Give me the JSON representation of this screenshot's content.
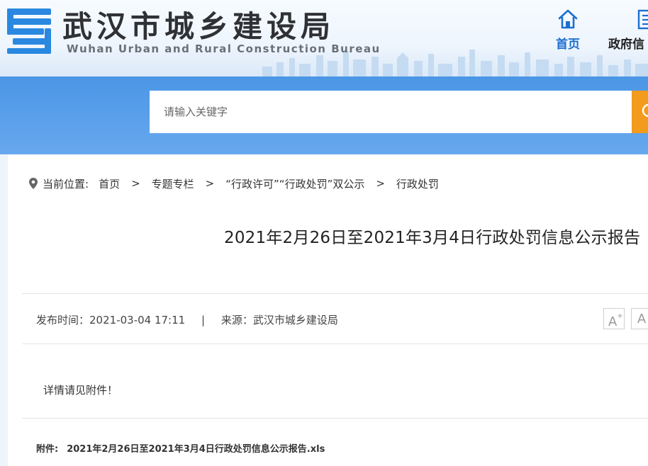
{
  "header": {
    "site_title": "武汉市城乡建设局",
    "site_subtitle": "Wuhan Urban and Rural Construction Bureau",
    "logo_icon": "bureau-logo-icon",
    "nav": [
      {
        "label": "首页",
        "icon": "home-icon",
        "active": true
      },
      {
        "label": "政府信",
        "icon": "document-icon",
        "active": false
      }
    ]
  },
  "search": {
    "placeholder": "请输入关键字",
    "button_icon": "search-icon"
  },
  "breadcrumb": {
    "prefix": "当前位置:",
    "items": [
      "首页",
      "专题专栏",
      "“行政许可”“行政处罚”双公示",
      "行政处罚"
    ],
    "separator": ">"
  },
  "article": {
    "title": "2021年2月26日至2021年3月4日行政处罚信息公示报告",
    "publish_label": "发布时间：",
    "publish_time": "2021-03-04 17:11",
    "pipe": "|",
    "source_label": "来源：",
    "source": "武汉市城乡建设局",
    "font_larger": "A",
    "font_smaller": "A",
    "body": "详情请见附件！",
    "attachment_label": "附件:",
    "attachment_file": "2021年2月26日至2021年3月4日行政处罚信息公示报告.xls"
  },
  "colors": {
    "accent_blue": "#1b6fd0",
    "band_blue": "#4b96e6",
    "search_button": "#f29b1c",
    "logo_blue": "#2a88e0"
  }
}
